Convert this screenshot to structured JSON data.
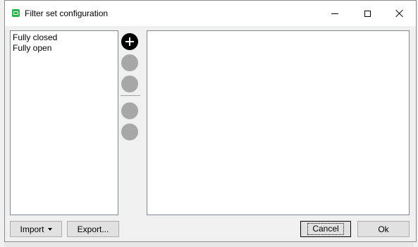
{
  "window": {
    "title": "Filter set configuration"
  },
  "filter_list": {
    "items": [
      "Fully closed",
      "Fully open"
    ]
  },
  "side_buttons": {
    "add_icon": "plus-icon"
  },
  "buttons": {
    "import_label": "Import",
    "export_label": "Export...",
    "cancel_label": "Cancel",
    "ok_label": "Ok"
  },
  "colors": {
    "active_button": "#000000",
    "disabled_button": "#a7a7a7",
    "app_icon": "#2bb24c"
  }
}
